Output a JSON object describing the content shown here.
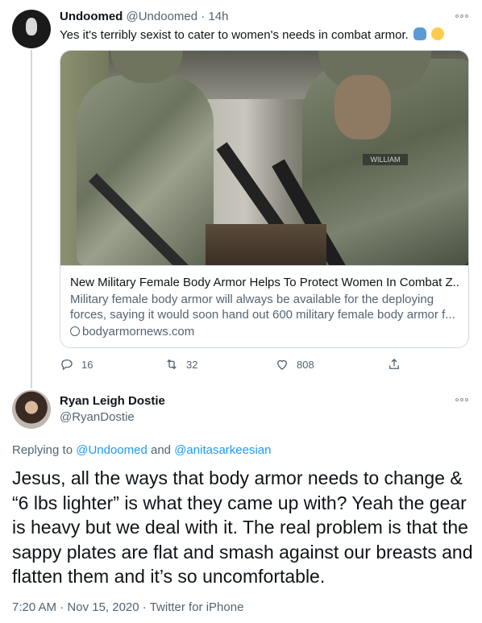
{
  "tweet1": {
    "name": "Undoomed",
    "handle": "@Undoomed",
    "separator": "·",
    "time": "14h",
    "text": "Yes it's terribly sexist to cater to women's needs in combat armor.",
    "emojis": [
      "person-facepalming-emoji",
      "upside-down-face-emoji"
    ],
    "card": {
      "image_nametag": "WILLIAM",
      "title": "New Military Female Body Armor Helps To Protect Women In Combat Z...",
      "description_lines": [
        "Military female body armor will always be available for the deploying",
        "forces, saying it would soon hand out 600 military female body armor f..."
      ],
      "domain": "bodyarmornews.com"
    },
    "actions": {
      "reply_count": "16",
      "retweet_count": "32",
      "like_count": "808"
    }
  },
  "tweet2": {
    "name": "Ryan Leigh Dostie",
    "handle": "@RyanDostie",
    "replying_prefix": "Replying to",
    "reply_to_1": "@Undoomed",
    "reply_and": "and",
    "reply_to_2": "@anitasarkeesian",
    "body_lines": [
      "Jesus, all the ways that body armor needs to change &",
      "“6 lbs lighter” is what they came up with? Yeah the gear",
      "is heavy but we deal with it. The real problem is that the",
      "sappy plates are flat and smash against our breasts and",
      "flatten them and it’s so uncomfortable."
    ],
    "time": "7:20 AM",
    "date": "Nov 15, 2020",
    "meta_sep": "·",
    "source": "Twitter for iPhone"
  },
  "colors": {
    "text": "#0f1419",
    "secondary": "#536471",
    "link": "#1d9bf0",
    "border": "#cfd9de"
  }
}
